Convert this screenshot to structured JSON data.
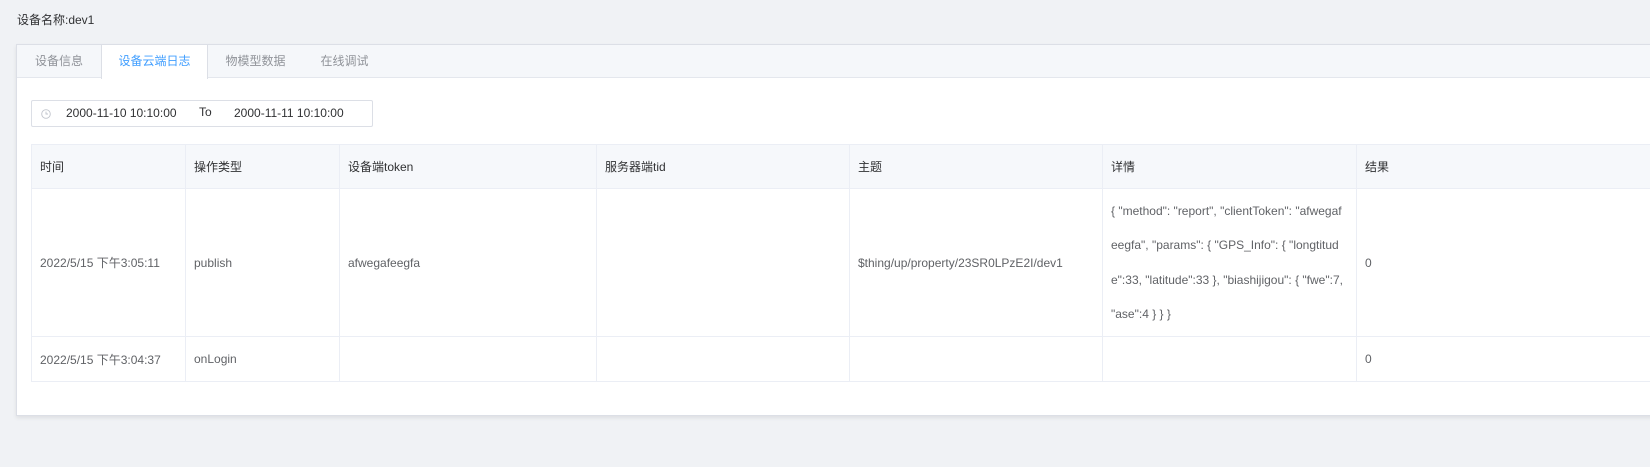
{
  "page": {
    "title": "设备名称:dev1"
  },
  "tabs": [
    {
      "label": "设备信息",
      "active": false
    },
    {
      "label": "设备云端日志",
      "active": true
    },
    {
      "label": "物模型数据",
      "active": false
    },
    {
      "label": "在线调试",
      "active": false
    }
  ],
  "date_range": {
    "icon": "clock-icon",
    "start": "2000-11-10 10:10:00",
    "separator": "To",
    "end": "2000-11-11 10:10:00"
  },
  "table": {
    "columns": [
      "时间",
      "操作类型",
      "设备端token",
      "服务器端tid",
      "主题",
      "详情",
      "结果"
    ],
    "rows": [
      {
        "time": "2022/5/15 下午3:05:11",
        "type": "publish",
        "token": "afwegafeegfa",
        "tid": "",
        "topic": "$thing/up/property/23SR0LPzE2I/dev1",
        "detail": "{ \"method\": \"report\", \"clientToken\": \"afwegafeegfa\", \"params\": { \"GPS_Info\": { \"longtitude\":33, \"latitude\":33 }, \"biashijigou\": { \"fwe\":7, \"ase\":4 } } }",
        "result": "0"
      },
      {
        "time": "2022/5/15 下午3:04:37",
        "type": "onLogin",
        "token": "",
        "tid": "",
        "topic": "",
        "detail": "",
        "result": "0"
      }
    ]
  },
  "colors": {
    "accent": "#409eff",
    "page_bg": "#f0f2f5",
    "border": "#ebeef5"
  }
}
